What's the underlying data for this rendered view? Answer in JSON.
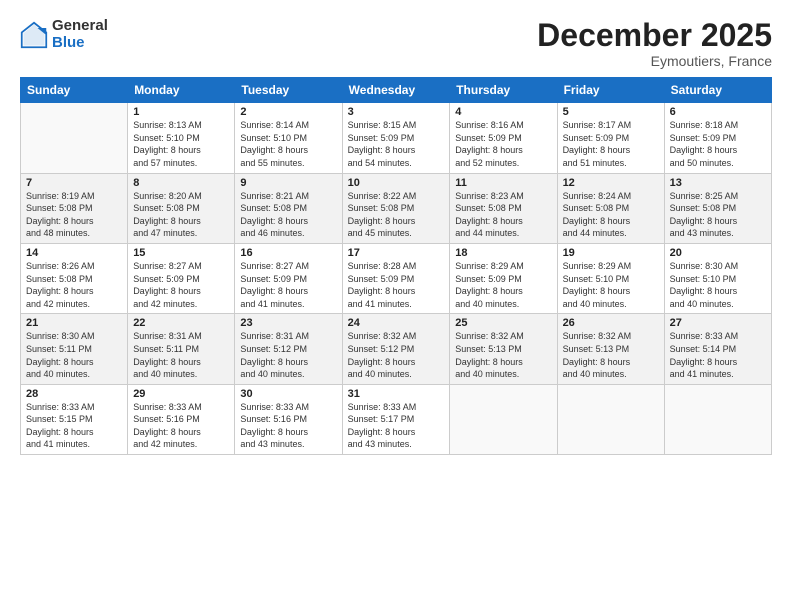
{
  "logo": {
    "general": "General",
    "blue": "Blue"
  },
  "title": "December 2025",
  "location": "Eymoutiers, France",
  "days_header": [
    "Sunday",
    "Monday",
    "Tuesday",
    "Wednesday",
    "Thursday",
    "Friday",
    "Saturday"
  ],
  "weeks": [
    [
      {
        "day": "",
        "info": ""
      },
      {
        "day": "1",
        "info": "Sunrise: 8:13 AM\nSunset: 5:10 PM\nDaylight: 8 hours\nand 57 minutes."
      },
      {
        "day": "2",
        "info": "Sunrise: 8:14 AM\nSunset: 5:10 PM\nDaylight: 8 hours\nand 55 minutes."
      },
      {
        "day": "3",
        "info": "Sunrise: 8:15 AM\nSunset: 5:09 PM\nDaylight: 8 hours\nand 54 minutes."
      },
      {
        "day": "4",
        "info": "Sunrise: 8:16 AM\nSunset: 5:09 PM\nDaylight: 8 hours\nand 52 minutes."
      },
      {
        "day": "5",
        "info": "Sunrise: 8:17 AM\nSunset: 5:09 PM\nDaylight: 8 hours\nand 51 minutes."
      },
      {
        "day": "6",
        "info": "Sunrise: 8:18 AM\nSunset: 5:09 PM\nDaylight: 8 hours\nand 50 minutes."
      }
    ],
    [
      {
        "day": "7",
        "info": "Sunrise: 8:19 AM\nSunset: 5:08 PM\nDaylight: 8 hours\nand 48 minutes."
      },
      {
        "day": "8",
        "info": "Sunrise: 8:20 AM\nSunset: 5:08 PM\nDaylight: 8 hours\nand 47 minutes."
      },
      {
        "day": "9",
        "info": "Sunrise: 8:21 AM\nSunset: 5:08 PM\nDaylight: 8 hours\nand 46 minutes."
      },
      {
        "day": "10",
        "info": "Sunrise: 8:22 AM\nSunset: 5:08 PM\nDaylight: 8 hours\nand 45 minutes."
      },
      {
        "day": "11",
        "info": "Sunrise: 8:23 AM\nSunset: 5:08 PM\nDaylight: 8 hours\nand 44 minutes."
      },
      {
        "day": "12",
        "info": "Sunrise: 8:24 AM\nSunset: 5:08 PM\nDaylight: 8 hours\nand 44 minutes."
      },
      {
        "day": "13",
        "info": "Sunrise: 8:25 AM\nSunset: 5:08 PM\nDaylight: 8 hours\nand 43 minutes."
      }
    ],
    [
      {
        "day": "14",
        "info": "Sunrise: 8:26 AM\nSunset: 5:08 PM\nDaylight: 8 hours\nand 42 minutes."
      },
      {
        "day": "15",
        "info": "Sunrise: 8:27 AM\nSunset: 5:09 PM\nDaylight: 8 hours\nand 42 minutes."
      },
      {
        "day": "16",
        "info": "Sunrise: 8:27 AM\nSunset: 5:09 PM\nDaylight: 8 hours\nand 41 minutes."
      },
      {
        "day": "17",
        "info": "Sunrise: 8:28 AM\nSunset: 5:09 PM\nDaylight: 8 hours\nand 41 minutes."
      },
      {
        "day": "18",
        "info": "Sunrise: 8:29 AM\nSunset: 5:09 PM\nDaylight: 8 hours\nand 40 minutes."
      },
      {
        "day": "19",
        "info": "Sunrise: 8:29 AM\nSunset: 5:10 PM\nDaylight: 8 hours\nand 40 minutes."
      },
      {
        "day": "20",
        "info": "Sunrise: 8:30 AM\nSunset: 5:10 PM\nDaylight: 8 hours\nand 40 minutes."
      }
    ],
    [
      {
        "day": "21",
        "info": "Sunrise: 8:30 AM\nSunset: 5:11 PM\nDaylight: 8 hours\nand 40 minutes."
      },
      {
        "day": "22",
        "info": "Sunrise: 8:31 AM\nSunset: 5:11 PM\nDaylight: 8 hours\nand 40 minutes."
      },
      {
        "day": "23",
        "info": "Sunrise: 8:31 AM\nSunset: 5:12 PM\nDaylight: 8 hours\nand 40 minutes."
      },
      {
        "day": "24",
        "info": "Sunrise: 8:32 AM\nSunset: 5:12 PM\nDaylight: 8 hours\nand 40 minutes."
      },
      {
        "day": "25",
        "info": "Sunrise: 8:32 AM\nSunset: 5:13 PM\nDaylight: 8 hours\nand 40 minutes."
      },
      {
        "day": "26",
        "info": "Sunrise: 8:32 AM\nSunset: 5:13 PM\nDaylight: 8 hours\nand 40 minutes."
      },
      {
        "day": "27",
        "info": "Sunrise: 8:33 AM\nSunset: 5:14 PM\nDaylight: 8 hours\nand 41 minutes."
      }
    ],
    [
      {
        "day": "28",
        "info": "Sunrise: 8:33 AM\nSunset: 5:15 PM\nDaylight: 8 hours\nand 41 minutes."
      },
      {
        "day": "29",
        "info": "Sunrise: 8:33 AM\nSunset: 5:16 PM\nDaylight: 8 hours\nand 42 minutes."
      },
      {
        "day": "30",
        "info": "Sunrise: 8:33 AM\nSunset: 5:16 PM\nDaylight: 8 hours\nand 43 minutes."
      },
      {
        "day": "31",
        "info": "Sunrise: 8:33 AM\nSunset: 5:17 PM\nDaylight: 8 hours\nand 43 minutes."
      },
      {
        "day": "",
        "info": ""
      },
      {
        "day": "",
        "info": ""
      },
      {
        "day": "",
        "info": ""
      }
    ]
  ]
}
